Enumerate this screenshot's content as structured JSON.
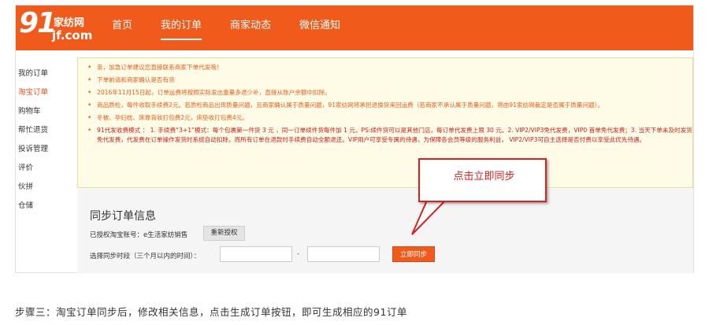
{
  "logo": {
    "number": "91",
    "cn": "家纺网",
    "domain": "jf.com"
  },
  "nav": [
    {
      "label": "首页",
      "active": false
    },
    {
      "label": "我的订单",
      "active": true
    },
    {
      "label": "商家动态",
      "active": false
    },
    {
      "label": "微信通知",
      "active": false
    }
  ],
  "sidebar": [
    {
      "label": "我的订单",
      "active": false
    },
    {
      "label": "淘宝订单",
      "active": true
    },
    {
      "label": "购物车",
      "active": false
    },
    {
      "label": "帮忙退货",
      "active": false
    },
    {
      "label": "投诉管理",
      "active": false
    },
    {
      "label": "评价",
      "active": false
    },
    {
      "label": "伙拼",
      "active": false
    },
    {
      "label": "仓储",
      "active": false
    }
  ],
  "notices": [
    "亲，加急订单建议您直接联系商家下单代发哦！",
    "下单前请和商家确认是否有货",
    "2016年11月15日起，订单运费将按照实际发出重量多退少补，直接从账户余额中扣除。",
    "商品质检，每件收取手续费2元。若质检商品出现质量问题，且商家确认属于质量问题，91家纺网将承担退换货来回运费（若商家不承认属于质量问题，将由91家纺网裁定是否属于质量问题）。",
    "冬被、孕妇枕、床靠背收打包费2元，床垫收打包费4元。",
    "91代发收费模式 ： 1. 手续费“3+1”模式：每个包裹第一件货 3 元 ，同一订单续件货每件加 1 元，PS:续件货可以是其他门店，每订单代发费上限 30 元。2. VIP2/VIP3免代发费，VIP0 首单免代发费；3. 当天下单未及时发货免代发费，代发费在订单操作发货时系统自动扣除，而所有订单在退款时手续费自动全额退还。VIP用户可享受专属的待遇，为保障各会员等级的服务利益，  VIP2/VIP3可自主选择是否付费以享受此优先待遇。"
  ],
  "sync": {
    "title": "同步订单信息",
    "auth_label": "已授权淘宝账号：e生活家纺销售",
    "reauth_button": "重新授权",
    "period_label": "选择同步时段（三个月以内的时间）：",
    "start_value": "",
    "end_value": "",
    "separator": "-",
    "sync_button": "立即同步"
  },
  "callout": {
    "text": "点击立即同步"
  },
  "step_text": "步骤三：淘宝订单同步后，修改相关信息，点击生成订单按钮，即可生成相应的91订单",
  "colors": {
    "brand": "#f05a1a",
    "notice_text": "#e85f1a",
    "callout_red": "#d9201f",
    "notice_bg": "#fefbe7"
  }
}
